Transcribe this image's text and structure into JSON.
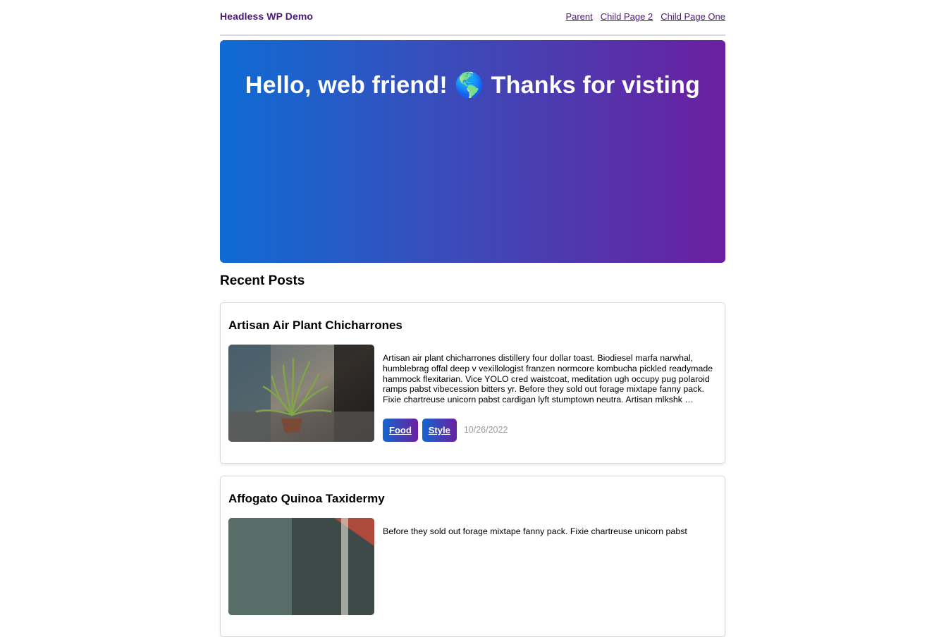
{
  "header": {
    "site_title": "Headless WP Demo",
    "nav": [
      "Parent",
      "Child Page 2",
      "Child Page One"
    ]
  },
  "hero": {
    "heading": "Hello, web friend! 🌎 Thanks for visting"
  },
  "posts_section": {
    "title": "Recent Posts",
    "posts": [
      {
        "title": "Artisan Air Plant Chicharrones",
        "excerpt": "Artisan air plant chicharrones distillery four dollar toast. Biodiesel marfa narwhal, humblebrag offal deep v vexillologist franzen normcore kombucha pickled readymade hammock flexitarian. Vice YOLO cred waistcoat, meditation ugh occupy pug polaroid ramps pabst vibecession bitters yr. Before they sold out forage mixtape fanny pack. Fixie chartreuse unicorn pabst cardigan lyft stumptown neutra. Artisan mlkshk …",
        "tags": [
          "Food",
          "Style"
        ],
        "date": "10/26/2022",
        "image": "air-plant-photo"
      },
      {
        "title": "Affogato Quinoa Taxidermy",
        "excerpt": "Before they sold out forage mixtape fanny pack. Fixie chartreuse unicorn pabst",
        "image": "affogato-photo"
      }
    ]
  },
  "colors": {
    "brand_purple": "#4b1a78",
    "gradient_start": "#0f6bd4",
    "gradient_end": "#6b1fa0"
  }
}
